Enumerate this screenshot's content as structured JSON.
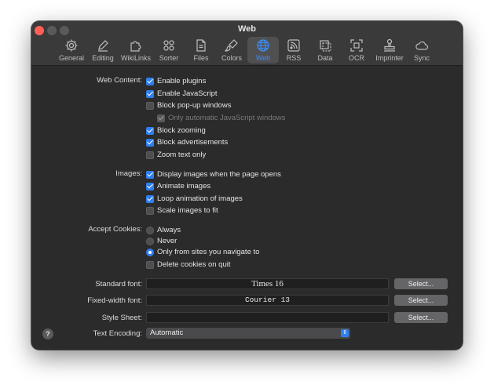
{
  "window": {
    "title": "Web"
  },
  "toolbar": {
    "items": [
      {
        "label": "General",
        "icon": "gear-icon"
      },
      {
        "label": "Editing",
        "icon": "pencil-icon"
      },
      {
        "label": "WikiLinks",
        "icon": "puzzle-icon"
      },
      {
        "label": "Sorter",
        "icon": "sorter-icon"
      },
      {
        "label": "Files",
        "icon": "file-icon"
      },
      {
        "label": "Colors",
        "icon": "brush-icon"
      },
      {
        "label": "Web",
        "icon": "globe-icon",
        "active": true
      },
      {
        "label": "RSS",
        "icon": "rss-icon"
      },
      {
        "label": "Data",
        "icon": "data-icon"
      },
      {
        "label": "OCR",
        "icon": "ocr-icon"
      },
      {
        "label": "Imprinter",
        "icon": "stamp-icon"
      },
      {
        "label": "Sync",
        "icon": "cloud-icon"
      }
    ]
  },
  "web_content": {
    "label": "Web Content:",
    "options": [
      {
        "label": "Enable plugins",
        "checked": true
      },
      {
        "label": "Enable JavaScript",
        "checked": true
      },
      {
        "label": "Block pop-up windows",
        "checked": false
      },
      {
        "label": "Only automatic JavaScript windows",
        "checked": true,
        "disabled": true
      },
      {
        "label": "Block zooming",
        "checked": true
      },
      {
        "label": "Block advertisements",
        "checked": true
      },
      {
        "label": "Zoom text only",
        "checked": false
      }
    ]
  },
  "images": {
    "label": "Images:",
    "options": [
      {
        "label": "Display images when the page opens",
        "checked": true
      },
      {
        "label": "Animate images",
        "checked": true
      },
      {
        "label": "Loop animation of images",
        "checked": true
      },
      {
        "label": "Scale images to fit",
        "checked": false
      }
    ]
  },
  "cookies": {
    "label": "Accept Cookies:",
    "options": [
      {
        "label": "Always",
        "selected": false
      },
      {
        "label": "Never",
        "selected": false
      },
      {
        "label": "Only from sites you navigate to",
        "selected": true
      }
    ],
    "delete_on_quit": {
      "label": "Delete cookies on quit",
      "checked": false
    }
  },
  "fonts": {
    "standard": {
      "label": "Standard font:",
      "value": "Times 16",
      "button": "Select..."
    },
    "fixed": {
      "label": "Fixed-width font:",
      "value": "Courier 13",
      "button": "Select..."
    },
    "stylesheet": {
      "label": "Style Sheet:",
      "value": "",
      "button": "Select..."
    }
  },
  "encoding": {
    "label": "Text Encoding:",
    "value": "Automatic"
  },
  "help": {
    "label": "?"
  },
  "colors": {
    "accent": "#2f7ff0",
    "window_bg": "#2b2b2c",
    "titlebar_bg": "#3a3a3b"
  }
}
